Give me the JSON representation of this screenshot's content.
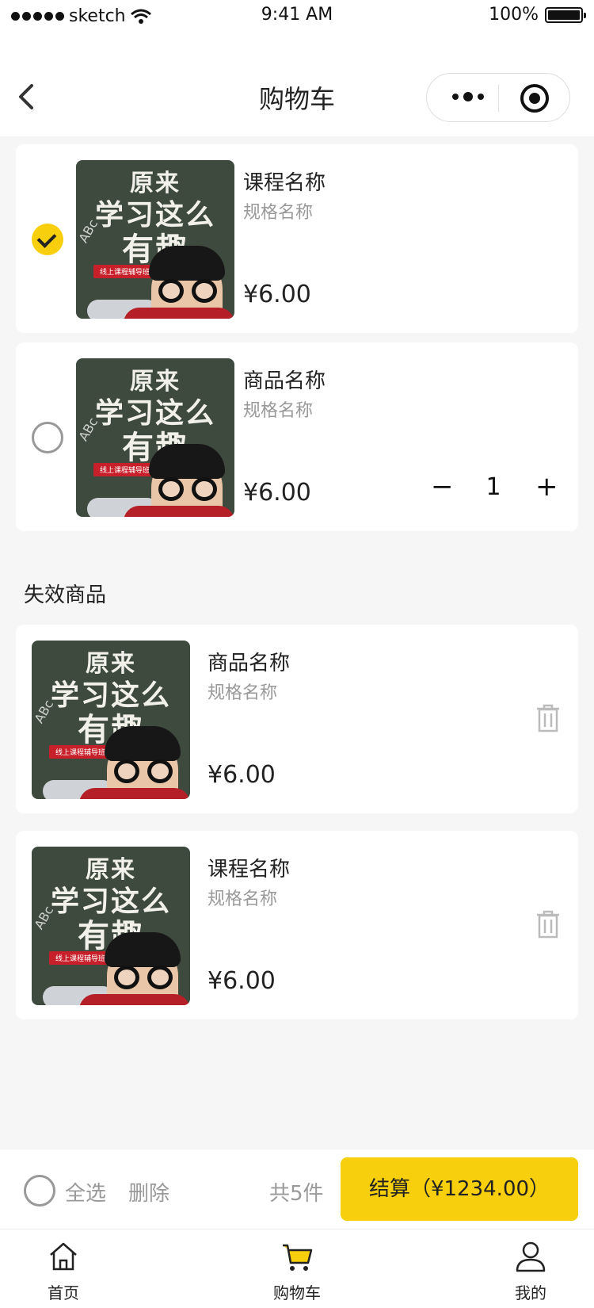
{
  "status_bar": {
    "carrier": "sketch",
    "time": "9:41 AM",
    "battery": "100%"
  },
  "nav": {
    "title": "购物车"
  },
  "thumbnail": {
    "line1": "原来",
    "line2": "学习这么",
    "line3": "有趣",
    "abc": "ABc",
    "tag": "线上课程辅导班"
  },
  "cart_items": [
    {
      "name": "课程名称",
      "spec": "规格名称",
      "price": "¥6.00",
      "checked": true
    },
    {
      "name": "商品名称",
      "spec": "规格名称",
      "price": "¥6.00",
      "checked": false,
      "quantity": "1",
      "minus": "−",
      "plus": "+"
    }
  ],
  "invalid_section": {
    "title": "失效商品",
    "items": [
      {
        "name": "商品名称",
        "spec": "规格名称",
        "price": "¥6.00"
      },
      {
        "name": "课程名称",
        "spec": "规格名称",
        "price": "¥6.00"
      }
    ]
  },
  "action_bar": {
    "select_all": "全选",
    "delete": "删除",
    "count": "共5件",
    "checkout": "结算（¥1234.00）"
  },
  "tab_bar": {
    "tabs": [
      {
        "label": "首页",
        "icon": "home-icon"
      },
      {
        "label": "购物车",
        "icon": "cart-icon"
      },
      {
        "label": "我的",
        "icon": "user-icon"
      }
    ]
  },
  "colors": {
    "accent": "#f8cf0d",
    "background": "#f6f6f6",
    "muted_text": "#999999"
  }
}
